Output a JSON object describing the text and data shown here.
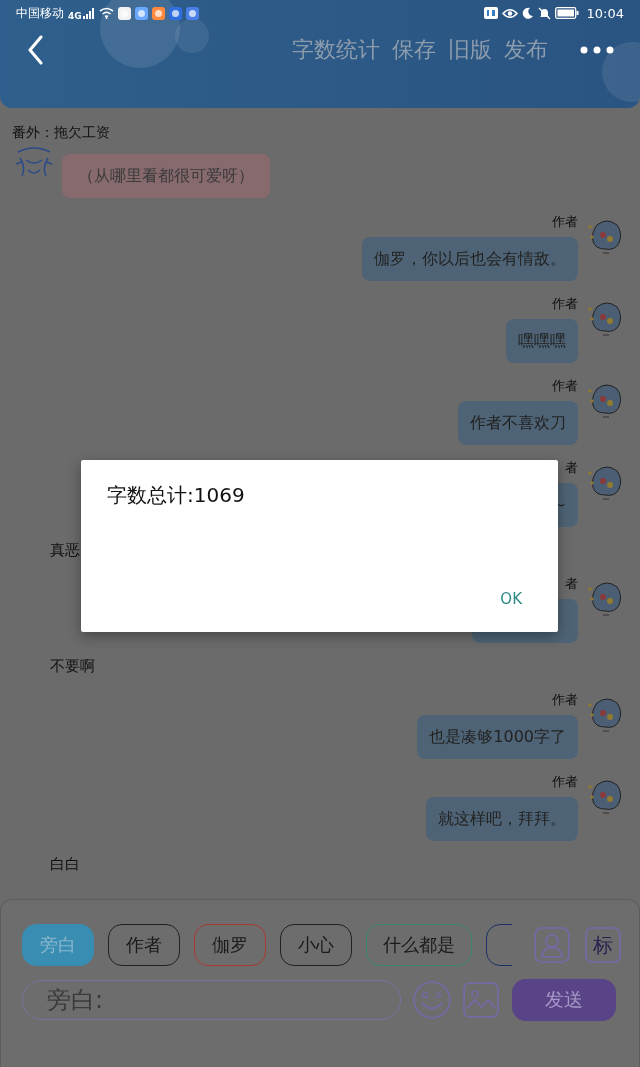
{
  "status_bar": {
    "carrier": "中国移动",
    "network": "4G",
    "time": "10:04"
  },
  "toolbar": {
    "actions": [
      "字数统计",
      "保存",
      "旧版",
      "发布"
    ]
  },
  "chapter_title": "番外：拖欠工资",
  "messages": [
    {
      "kind": "left",
      "text": "（从哪里看都很可爱呀）"
    },
    {
      "kind": "author",
      "name": "作者",
      "text": "伽罗，你以后也会有情敌。"
    },
    {
      "kind": "author",
      "name": "作者",
      "text": "嘿嘿嘿"
    },
    {
      "kind": "author",
      "name": "作者",
      "text": "作者不喜欢刀"
    },
    {
      "kind": "author",
      "name": "者",
      "text": "~"
    },
    {
      "kind": "narration",
      "text": "真恶"
    },
    {
      "kind": "author",
      "name": "者"
    },
    {
      "kind": "narration",
      "text": "不要啊"
    },
    {
      "kind": "author",
      "name": "作者",
      "text": "也是凑够1000字了"
    },
    {
      "kind": "author",
      "name": "作者",
      "text": "就这样吧，拜拜。"
    },
    {
      "kind": "narration",
      "text": "白白"
    }
  ],
  "composer": {
    "roles": [
      {
        "label": "旁白",
        "color": "#3a8db2",
        "selected": true
      },
      {
        "label": "作者",
        "color": "#222222",
        "selected": false
      },
      {
        "label": "伽罗",
        "color": "#a83a32",
        "selected": false
      },
      {
        "label": "小心",
        "color": "#222222",
        "selected": false
      },
      {
        "label": "什么都是",
        "color": "#3a8a6a",
        "selected": false
      },
      {
        "color": "#1c2f66",
        "selected": false
      }
    ],
    "mark_button": "标",
    "placeholder": "旁白:",
    "send": "发送"
  },
  "dialog": {
    "message": "字数总计:1069",
    "button": "OK"
  }
}
